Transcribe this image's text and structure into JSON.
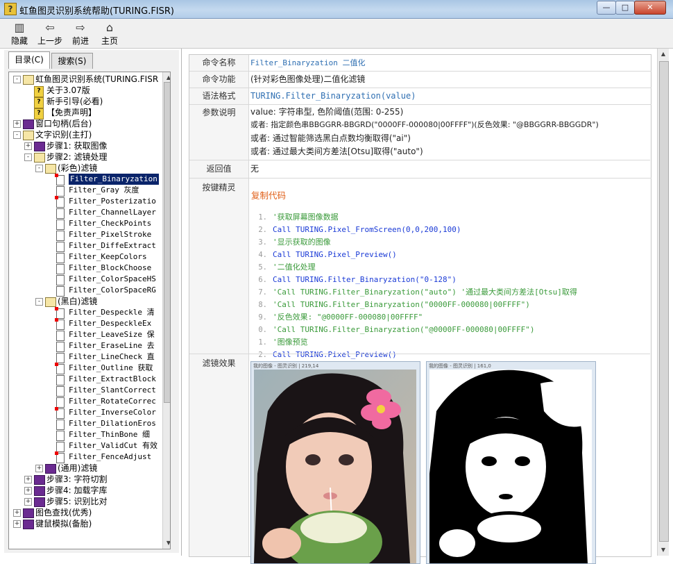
{
  "window": {
    "title": "虹鱼图灵识别系统帮助(TURING.FISR)",
    "min_label": "—",
    "max_label": "□",
    "close_label": "✕"
  },
  "toolbar": [
    {
      "label": "隐藏",
      "icon": "hide-icon"
    },
    {
      "label": "上一步",
      "icon": "back-arrow-icon"
    },
    {
      "label": "前进",
      "icon": "forward-arrow-icon"
    },
    {
      "label": "主页",
      "icon": "home-icon"
    }
  ],
  "tabs": [
    {
      "label": "目录(C)",
      "active": true
    },
    {
      "label": "搜索(S)",
      "active": false
    }
  ],
  "tree": [
    {
      "label": "虹鱼图灵识别系统(TURING.FISR",
      "level": 0,
      "icon": "open-book",
      "expander": "-"
    },
    {
      "label": "关于3.07版",
      "level": 1,
      "icon": "question",
      "expander": ""
    },
    {
      "label": "新手引导(必看)",
      "level": 1,
      "icon": "question",
      "expander": ""
    },
    {
      "label": "【免责声明】",
      "level": 1,
      "icon": "question",
      "expander": ""
    },
    {
      "label": "窗口句柄(后台)",
      "level": 0,
      "icon": "book",
      "expander": "+"
    },
    {
      "label": "文字识别(主打)",
      "level": 0,
      "icon": "open-book",
      "expander": "-"
    },
    {
      "label": "步骤1: 获取图像",
      "level": 1,
      "icon": "book",
      "expander": "+"
    },
    {
      "label": "步骤2: 滤镜处理",
      "level": 1,
      "icon": "open-book",
      "expander": "-"
    },
    {
      "label": "(彩色)滤镜",
      "level": 2,
      "icon": "open-book",
      "expander": "-"
    },
    {
      "label": "Filter_Binaryzation",
      "level": 3,
      "icon": "page-red",
      "expander": "",
      "selected": true,
      "mono": true
    },
    {
      "label": "Filter_Gray 灰度",
      "level": 3,
      "icon": "page",
      "expander": "",
      "mono": true
    },
    {
      "label": "Filter_Posterizatio",
      "level": 3,
      "icon": "page-red",
      "expander": "",
      "mono": true
    },
    {
      "label": "Filter_ChannelLayer",
      "level": 3,
      "icon": "page",
      "expander": "",
      "mono": true
    },
    {
      "label": "Filter_CheckPoints",
      "level": 3,
      "icon": "page",
      "expander": "",
      "mono": true
    },
    {
      "label": "Filter_PixelStroke",
      "level": 3,
      "icon": "page",
      "expander": "",
      "mono": true
    },
    {
      "label": "Filter_DiffeExtract",
      "level": 3,
      "icon": "page",
      "expander": "",
      "mono": true
    },
    {
      "label": "Filter_KeepColors",
      "level": 3,
      "icon": "page",
      "expander": "",
      "mono": true
    },
    {
      "label": "Filter_BlockChoose",
      "level": 3,
      "icon": "page",
      "expander": "",
      "mono": true
    },
    {
      "label": "Filter_ColorSpaceHS",
      "level": 3,
      "icon": "page",
      "expander": "",
      "mono": true
    },
    {
      "label": "Filter_ColorSpaceRG",
      "level": 3,
      "icon": "page",
      "expander": "",
      "mono": true
    },
    {
      "label": "(黑白)滤镜",
      "level": 2,
      "icon": "open-book",
      "expander": "-"
    },
    {
      "label": "Filter_Despeckle 清",
      "level": 3,
      "icon": "page-red",
      "expander": "",
      "mono": true
    },
    {
      "label": "Filter_DespeckleEx",
      "level": 3,
      "icon": "page-red",
      "expander": "",
      "mono": true
    },
    {
      "label": "Filter_LeaveSize 保",
      "level": 3,
      "icon": "page",
      "expander": "",
      "mono": true
    },
    {
      "label": "Filter_EraseLine 去",
      "level": 3,
      "icon": "page",
      "expander": "",
      "mono": true
    },
    {
      "label": "Filter_LineCheck 直",
      "level": 3,
      "icon": "page",
      "expander": "",
      "mono": true
    },
    {
      "label": "Filter_Outline 获取",
      "level": 3,
      "icon": "page-red",
      "expander": "",
      "mono": true
    },
    {
      "label": "Filter_ExtractBlock",
      "level": 3,
      "icon": "page",
      "expander": "",
      "mono": true
    },
    {
      "label": "Filter_SlantCorrect",
      "level": 3,
      "icon": "page",
      "expander": "",
      "mono": true
    },
    {
      "label": "Filter_RotateCorrec",
      "level": 3,
      "icon": "page",
      "expander": "",
      "mono": true
    },
    {
      "label": "Filter_InverseColor",
      "level": 3,
      "icon": "page-red",
      "expander": "",
      "mono": true
    },
    {
      "label": "Filter_DilationEros",
      "level": 3,
      "icon": "page",
      "expander": "",
      "mono": true
    },
    {
      "label": "Filter_ThinBone 细",
      "level": 3,
      "icon": "page",
      "expander": "",
      "mono": true
    },
    {
      "label": "Filter_ValidCut 有效",
      "level": 3,
      "icon": "page",
      "expander": "",
      "mono": true
    },
    {
      "label": "Filter_FenceAdjust",
      "level": 3,
      "icon": "page-red",
      "expander": "",
      "mono": true
    },
    {
      "label": "(通用)滤镜",
      "level": 2,
      "icon": "book",
      "expander": "+"
    },
    {
      "label": "步骤3: 字符切割",
      "level": 1,
      "icon": "book",
      "expander": "+"
    },
    {
      "label": "步骤4: 加载字库",
      "level": 1,
      "icon": "book",
      "expander": "+"
    },
    {
      "label": "步骤5: 识别比对",
      "level": 1,
      "icon": "book",
      "expander": "+"
    },
    {
      "label": "图色查找(优秀)",
      "level": 0,
      "icon": "book",
      "expander": "+"
    },
    {
      "label": "键鼠模拟(备胎)",
      "level": 0,
      "icon": "book",
      "expander": "+"
    }
  ],
  "doc": {
    "cmd_name_label": "命令名称",
    "cmd_name_value": "Filter_Binaryzation 二值化",
    "cmd_func_label": "命令功能",
    "cmd_func_value": "(针对彩色图像处理)二值化滤镜",
    "syntax_label": "语法格式",
    "syntax_value": "TURING.Filter_Binaryzation(value)",
    "params_label": "参数说明",
    "params": [
      "value: 字符串型, 色阶阈值(范围: 0-255)",
      "或者: 指定颜色串BBGGRR-BBGRD(\"0000FF-000080|00FFFF\")(反色效果: \"@BBGGRR-BBGGDR\")",
      "或者: 通过智能筛选黑白点数均衡取得(\"ai\")",
      "或者: 通过最大类间方差法[Otsu]取得(\"auto\")"
    ],
    "return_label": "返回值",
    "return_value": "无",
    "example_label": "按键精灵",
    "copy_label": "复制代码",
    "code": [
      {
        "ln": "1.",
        "text": "'获取屏幕图像数据",
        "kind": "comment"
      },
      {
        "ln": "2.",
        "text": "Call TURING.Pixel_FromScreen(0,0,200,100)",
        "kind": "call"
      },
      {
        "ln": "3.",
        "text": "'显示获取的图像",
        "kind": "comment"
      },
      {
        "ln": "4.",
        "text": "Call TURING.Pixel_Preview()",
        "kind": "call"
      },
      {
        "ln": "5.",
        "text": "'二值化处理",
        "kind": "comment"
      },
      {
        "ln": "6.",
        "text": "Call TURING.Filter_Binaryzation(\"0-128\")",
        "kind": "call"
      },
      {
        "ln": "7.",
        "text": "'Call TURING.Filter_Binaryzation(\"auto\") '通过最大类间方差法[Otsu]取得",
        "kind": "comment"
      },
      {
        "ln": "8.",
        "text": "'Call TURING.Filter_Binaryzation(\"0000FF-000080|00FFFF\")",
        "kind": "comment"
      },
      {
        "ln": "9.",
        "text": "'反色效果: \"@0000FF-000080|00FFFF\"",
        "kind": "comment"
      },
      {
        "ln": "0.",
        "text": "'Call TURING.Filter_Binaryzation(\"@0000FF-000080|00FFFF\")",
        "kind": "comment"
      },
      {
        "ln": "1.",
        "text": "'图像预览",
        "kind": "comment"
      },
      {
        "ln": "2.",
        "text": "Call TURING.Pixel_Preview()",
        "kind": "call"
      }
    ],
    "effect_label": "滤镜效果",
    "img_left_caption": "我的图像 - 图灵识别 | 219,14",
    "img_right_caption": "我的图像 - 图灵识别 | 161,0"
  }
}
